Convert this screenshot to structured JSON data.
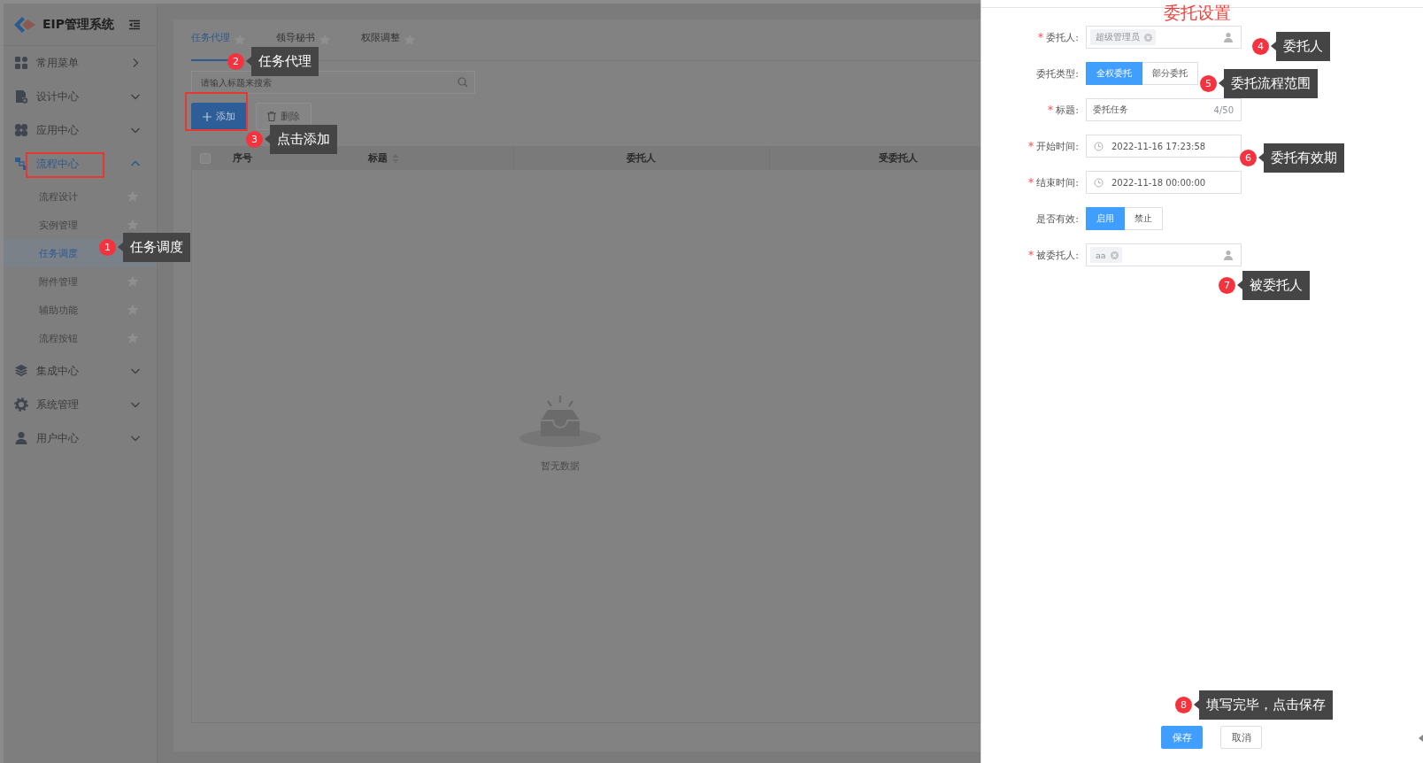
{
  "app": {
    "name": "EIP管理系统"
  },
  "sidebar": {
    "items": [
      {
        "label": "常用菜单",
        "kind": "link",
        "expanded": false
      },
      {
        "label": "设计中心",
        "kind": "group",
        "expanded": false
      },
      {
        "label": "应用中心",
        "kind": "group",
        "expanded": false
      },
      {
        "label": "流程中心",
        "kind": "group",
        "expanded": true,
        "children": [
          {
            "label": "流程设计",
            "selected": false
          },
          {
            "label": "实例管理",
            "selected": false
          },
          {
            "label": "任务调度",
            "selected": true
          },
          {
            "label": "附件管理",
            "selected": false
          },
          {
            "label": "辅助功能",
            "selected": false
          },
          {
            "label": "流程按钮",
            "selected": false
          }
        ]
      },
      {
        "label": "集成中心",
        "kind": "group",
        "expanded": false
      },
      {
        "label": "系统管理",
        "kind": "group",
        "expanded": false
      },
      {
        "label": "用户中心",
        "kind": "group",
        "expanded": false
      }
    ]
  },
  "tabs": [
    {
      "label": "任务代理",
      "selected": true
    },
    {
      "label": "领导秘书",
      "selected": false
    },
    {
      "label": "权限调整",
      "selected": false
    }
  ],
  "search": {
    "placeholder": "请输入标题来搜索"
  },
  "toolbar": [
    {
      "label": "添加",
      "kind": "primary",
      "disabled": false
    },
    {
      "label": "删除",
      "kind": "default",
      "disabled": true
    }
  ],
  "table": {
    "select_all": {
      "checked": false
    },
    "columns": [
      {
        "label": "序号",
        "sortable": false
      },
      {
        "label": "标题",
        "sortable": true
      },
      {
        "label": "委托人",
        "sortable": false
      },
      {
        "label": "受委托人",
        "sortable": false
      }
    ],
    "empty_text": "暂无数据"
  },
  "drawer": {
    "title": "委托设置",
    "fields": [
      {
        "kind": "user",
        "label": "委托人:",
        "required": true,
        "tags": [
          "超级管理员"
        ]
      },
      {
        "kind": "segmented",
        "label": "委托类型:",
        "required": false,
        "options": [
          {
            "label": "全权委托",
            "selected": true
          },
          {
            "label": "部分委托",
            "selected": false
          }
        ]
      },
      {
        "kind": "text",
        "label": "标题:",
        "required": true,
        "value": "委托任务",
        "counter": "4/50"
      },
      {
        "kind": "date",
        "label": "开始时间:",
        "required": true,
        "value": "2022-11-16 17:23:58"
      },
      {
        "kind": "date",
        "label": "结束时间:",
        "required": true,
        "value": "2022-11-18 00:00:00"
      },
      {
        "kind": "segmented",
        "label": "是否有效:",
        "required": false,
        "options": [
          {
            "label": "启用",
            "selected": true
          },
          {
            "label": "禁止",
            "selected": false
          }
        ]
      },
      {
        "kind": "user",
        "label": "被委托人:",
        "required": true,
        "tags": [
          "aa"
        ]
      }
    ],
    "buttons": [
      {
        "label": "保存",
        "kind": "primary"
      },
      {
        "label": "取消",
        "kind": "default"
      }
    ]
  },
  "callouts": [
    {
      "number": "1",
      "text": "任务调度"
    },
    {
      "number": "2",
      "text": "任务代理"
    },
    {
      "number": "3",
      "text": "点击添加"
    },
    {
      "number": "4",
      "text": "委托人"
    },
    {
      "number": "5",
      "text": "委托流程范围"
    },
    {
      "number": "6",
      "text": "委托有效期"
    },
    {
      "number": "7",
      "text": "被委托人"
    },
    {
      "number": "8",
      "text": "填写完毕，点击保存"
    }
  ]
}
